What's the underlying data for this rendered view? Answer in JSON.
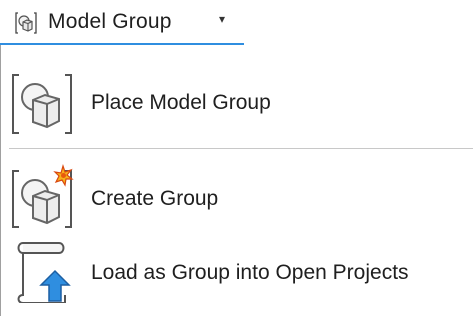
{
  "header": {
    "label": "Model  Group",
    "icon": "model-group-icon",
    "caret": "▾",
    "accent_color": "#2f8ee0"
  },
  "menu": {
    "items": [
      {
        "label": "Place Model Group",
        "icon": "place-model-group-icon"
      },
      {
        "label": "Create Group",
        "icon": "create-group-icon"
      },
      {
        "label": "Load as Group into Open Projects",
        "icon": "load-as-group-icon"
      }
    ]
  }
}
